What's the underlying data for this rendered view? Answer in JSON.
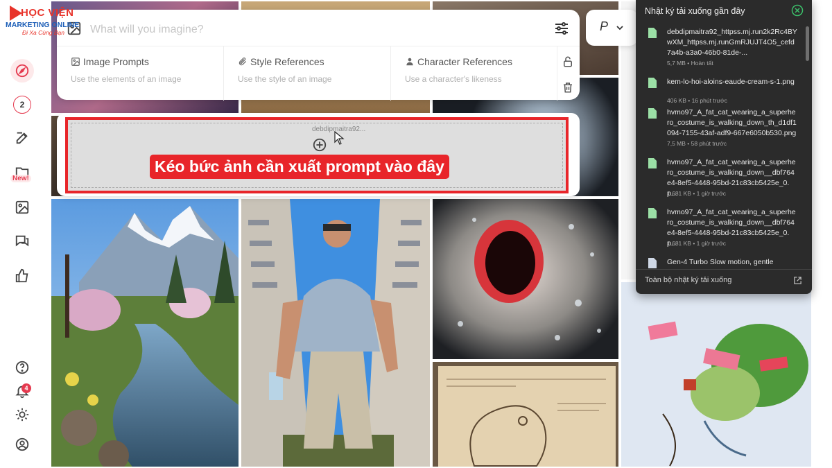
{
  "logo": {
    "brand": "HỌC VIỆN",
    "line2": "MARKETING ONLINE",
    "tagline": "Đi Xa Cùng Bạn",
    "partial_app_logo": "MJ"
  },
  "sidebar": {
    "items": [
      {
        "name": "explore",
        "icon": "compass-icon",
        "active": true
      },
      {
        "name": "queue",
        "badge": "2"
      },
      {
        "name": "create",
        "icon": "edit-icon"
      },
      {
        "name": "organize",
        "icon": "folder-icon",
        "badge": "New!"
      },
      {
        "name": "personalize",
        "icon": "image-icon"
      },
      {
        "name": "chat",
        "icon": "chat-icon"
      },
      {
        "name": "tasks",
        "icon": "thumbs-up-icon"
      },
      {
        "name": "help",
        "icon": "question-icon"
      },
      {
        "name": "updates",
        "icon": "bell-icon",
        "badge": "4"
      },
      {
        "name": "theme",
        "icon": "sun-icon"
      },
      {
        "name": "account",
        "icon": "user-icon"
      }
    ]
  },
  "prompt": {
    "placeholder": "What will you imagine?",
    "references": [
      {
        "title": "Image Prompts",
        "subtitle": "Use the elements of an image",
        "icon": "image-icon"
      },
      {
        "title": "Style References",
        "subtitle": "Use the style of an image",
        "icon": "paperclip-icon"
      },
      {
        "title": "Character References",
        "subtitle": "Use a character's likeness",
        "icon": "person-icon"
      }
    ],
    "mode_label": "P"
  },
  "drop_zone": {
    "dragged_file": "debdipmaitra92...",
    "overlay_label": "Kéo bức ảnh cần xuất prompt vào đây"
  },
  "downloads": {
    "title": "Nhật ký tải xuống gần đây",
    "footer": "Toàn bộ nhật ký tải xuống",
    "items": [
      {
        "name": "debdipmaitra92_httpss.mj.run2k2Rc4BYwXM_httpss.mj.runGmRJUJT4O5_cefd7a4b-a3a0-46b0-81de-...",
        "meta": "5,7 MB • Hoàn tất"
      },
      {
        "name": "kem-lo-hoi-aloins-eaude-cream-s-1.png",
        "meta": "406 KB • 16 phút trước"
      },
      {
        "name": "hvmo97_A_fat_cat_wearing_a_superhero_costume_is_walking_down_th_d1df1094-7155-43af-adf9-667e6050b530.png",
        "meta": "7,5 MB • 58 phút trước"
      },
      {
        "name": "hvmo97_A_fat_cat_wearing_a_superhero_costume_is_walking_down__dbf764e4-8ef5-4448-95bd-21c83cb5425e_0.p...",
        "meta": "1.681 KB • 1 giờ trước"
      },
      {
        "name": "hvmo97_A_fat_cat_wearing_a_superhero_costume_is_walking_down__dbf764e4-8ef5-4448-95bd-21c83cb5425e_0.p...",
        "meta": "1.681 KB • 1 giờ trước"
      },
      {
        "name": "Gen-4 Turbo Slow motion, gentle",
        "meta": ""
      }
    ]
  },
  "colors": {
    "accent": "#e53a4f",
    "highlight_red": "#e8252a",
    "panel_dark": "#2b2b2b"
  }
}
